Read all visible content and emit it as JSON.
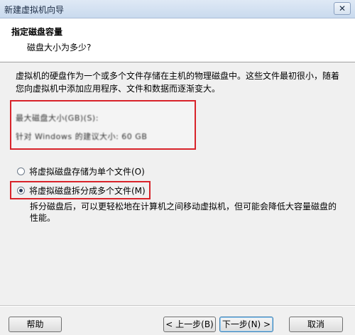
{
  "window": {
    "title": "新建虚拟机向导",
    "close_label": "✕"
  },
  "header": {
    "title": "指定磁盘容量",
    "subtitle": "磁盘大小为多少?"
  },
  "description": "虚拟机的硬盘作为一个或多个文件存储在主机的物理磁盘中。这些文件最初很小，随着您向虚拟机中添加应用程序、文件和数据而逐渐变大。",
  "disk_size": {
    "line1": "最大磁盘大小(GB)(S):",
    "line2": "针对 Windows 的建议大小: 60 GB"
  },
  "storage_options": [
    {
      "label": "将虚拟磁盘存储为单个文件(O)",
      "selected": false
    },
    {
      "label": "将虚拟磁盘拆分成多个文件(M)",
      "selected": true
    }
  ],
  "split_note": "拆分磁盘后，可以更轻松地在计算机之间移动虚拟机，但可能会降低大容量磁盘的性能。",
  "buttons": {
    "help": "帮助",
    "back": "< 上一步(B)",
    "next": "下一步(N) >",
    "cancel": "取消"
  }
}
